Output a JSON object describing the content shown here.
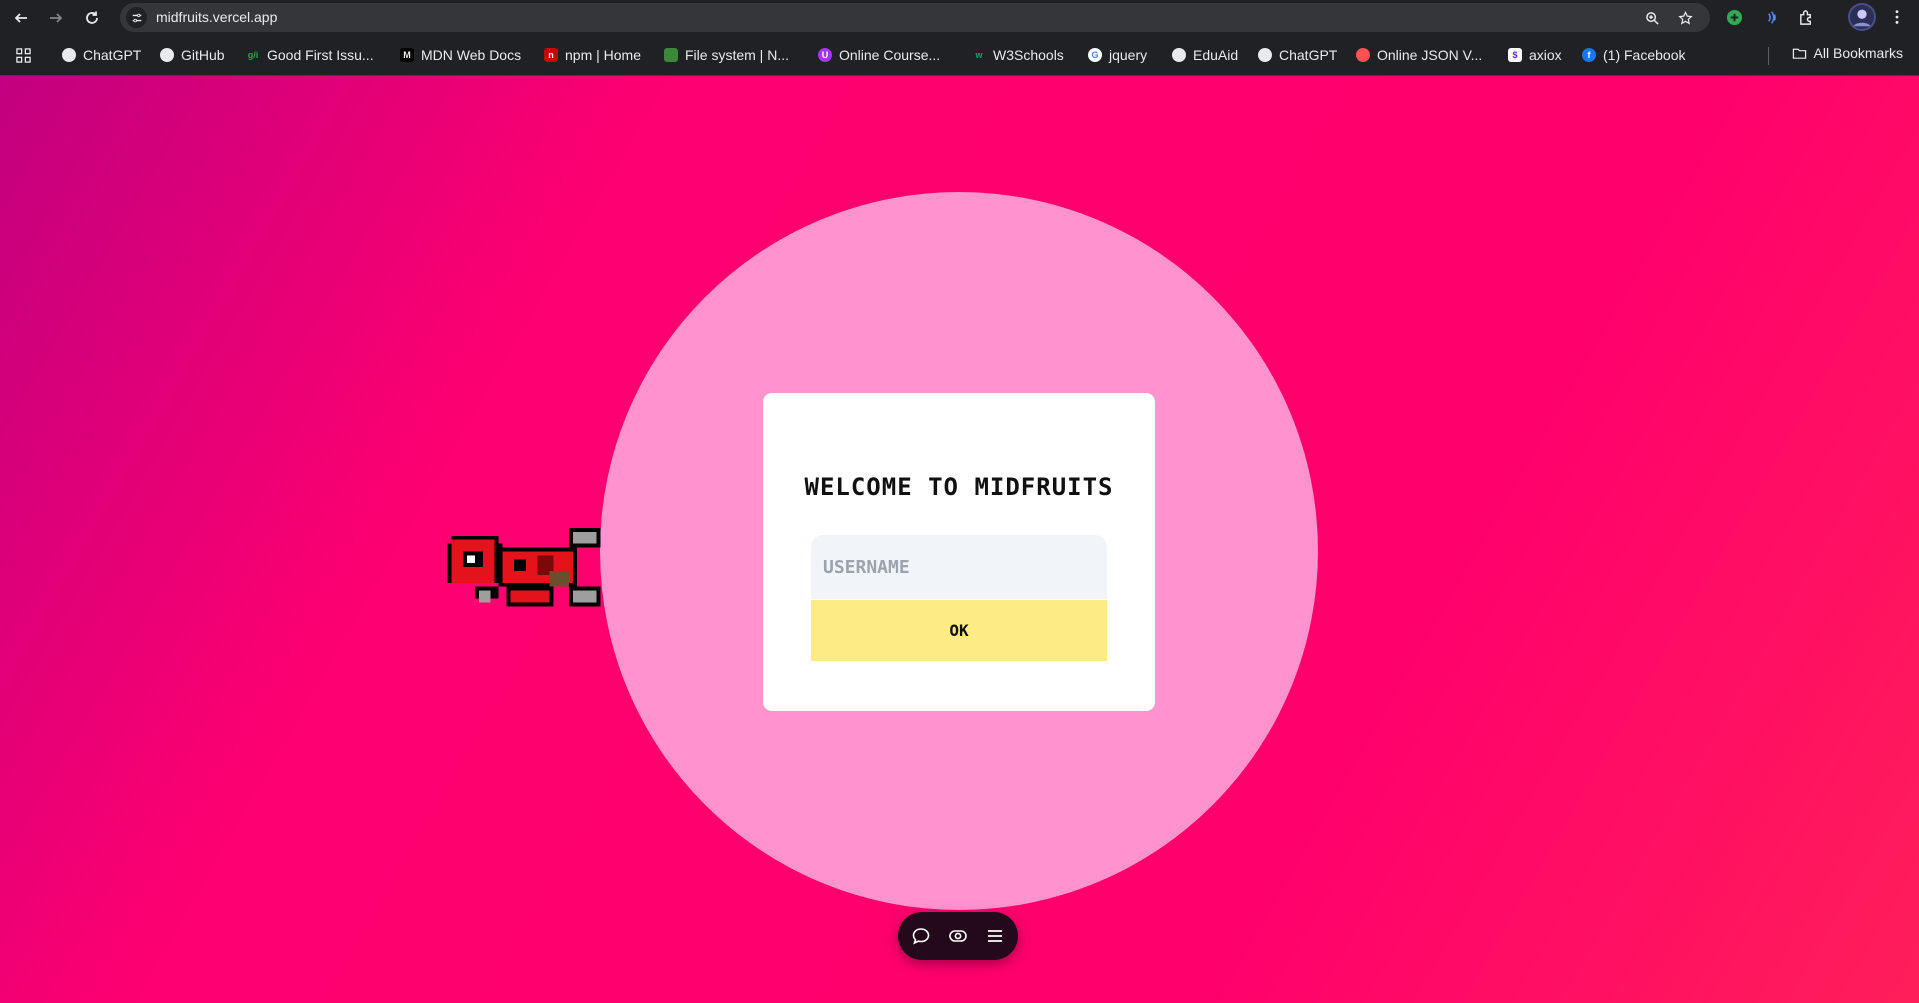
{
  "browser": {
    "url": "midfruits.vercel.app",
    "bookmarks": [
      {
        "label": "ChatGPT",
        "icon": "chatgpt-icon"
      },
      {
        "label": "GitHub",
        "icon": "github-icon"
      },
      {
        "label": "Good First Issu...",
        "icon": "gfi-icon"
      },
      {
        "label": "MDN Web Docs",
        "icon": "mdn-icon"
      },
      {
        "label": "npm | Home",
        "icon": "npm-icon"
      },
      {
        "label": "File system | N...",
        "icon": "nodejs-icon"
      },
      {
        "label": "Online Course...",
        "icon": "udemy-icon"
      },
      {
        "label": "W3Schools",
        "icon": "w3schools-icon"
      },
      {
        "label": "jquery",
        "icon": "google-icon"
      },
      {
        "label": "EduAid",
        "icon": "github-icon"
      },
      {
        "label": "ChatGPT",
        "icon": "chatgpt-icon"
      },
      {
        "label": "Online JSON V...",
        "icon": "json-icon"
      },
      {
        "label": "axiox",
        "icon": "axios-icon"
      },
      {
        "label": "(1) Facebook",
        "icon": "facebook-icon"
      }
    ],
    "all_bookmarks": "All Bookmarks"
  },
  "modal": {
    "title": "WELCOME TO MIDFRUITS",
    "username_placeholder": "USERNAME",
    "username_value": "",
    "ok_label": "OK"
  },
  "colors": {
    "accent_pink": "#ff006c",
    "circle": "#ff93cf",
    "ok_button": "#fdec86",
    "input": "#f1f5f9"
  }
}
